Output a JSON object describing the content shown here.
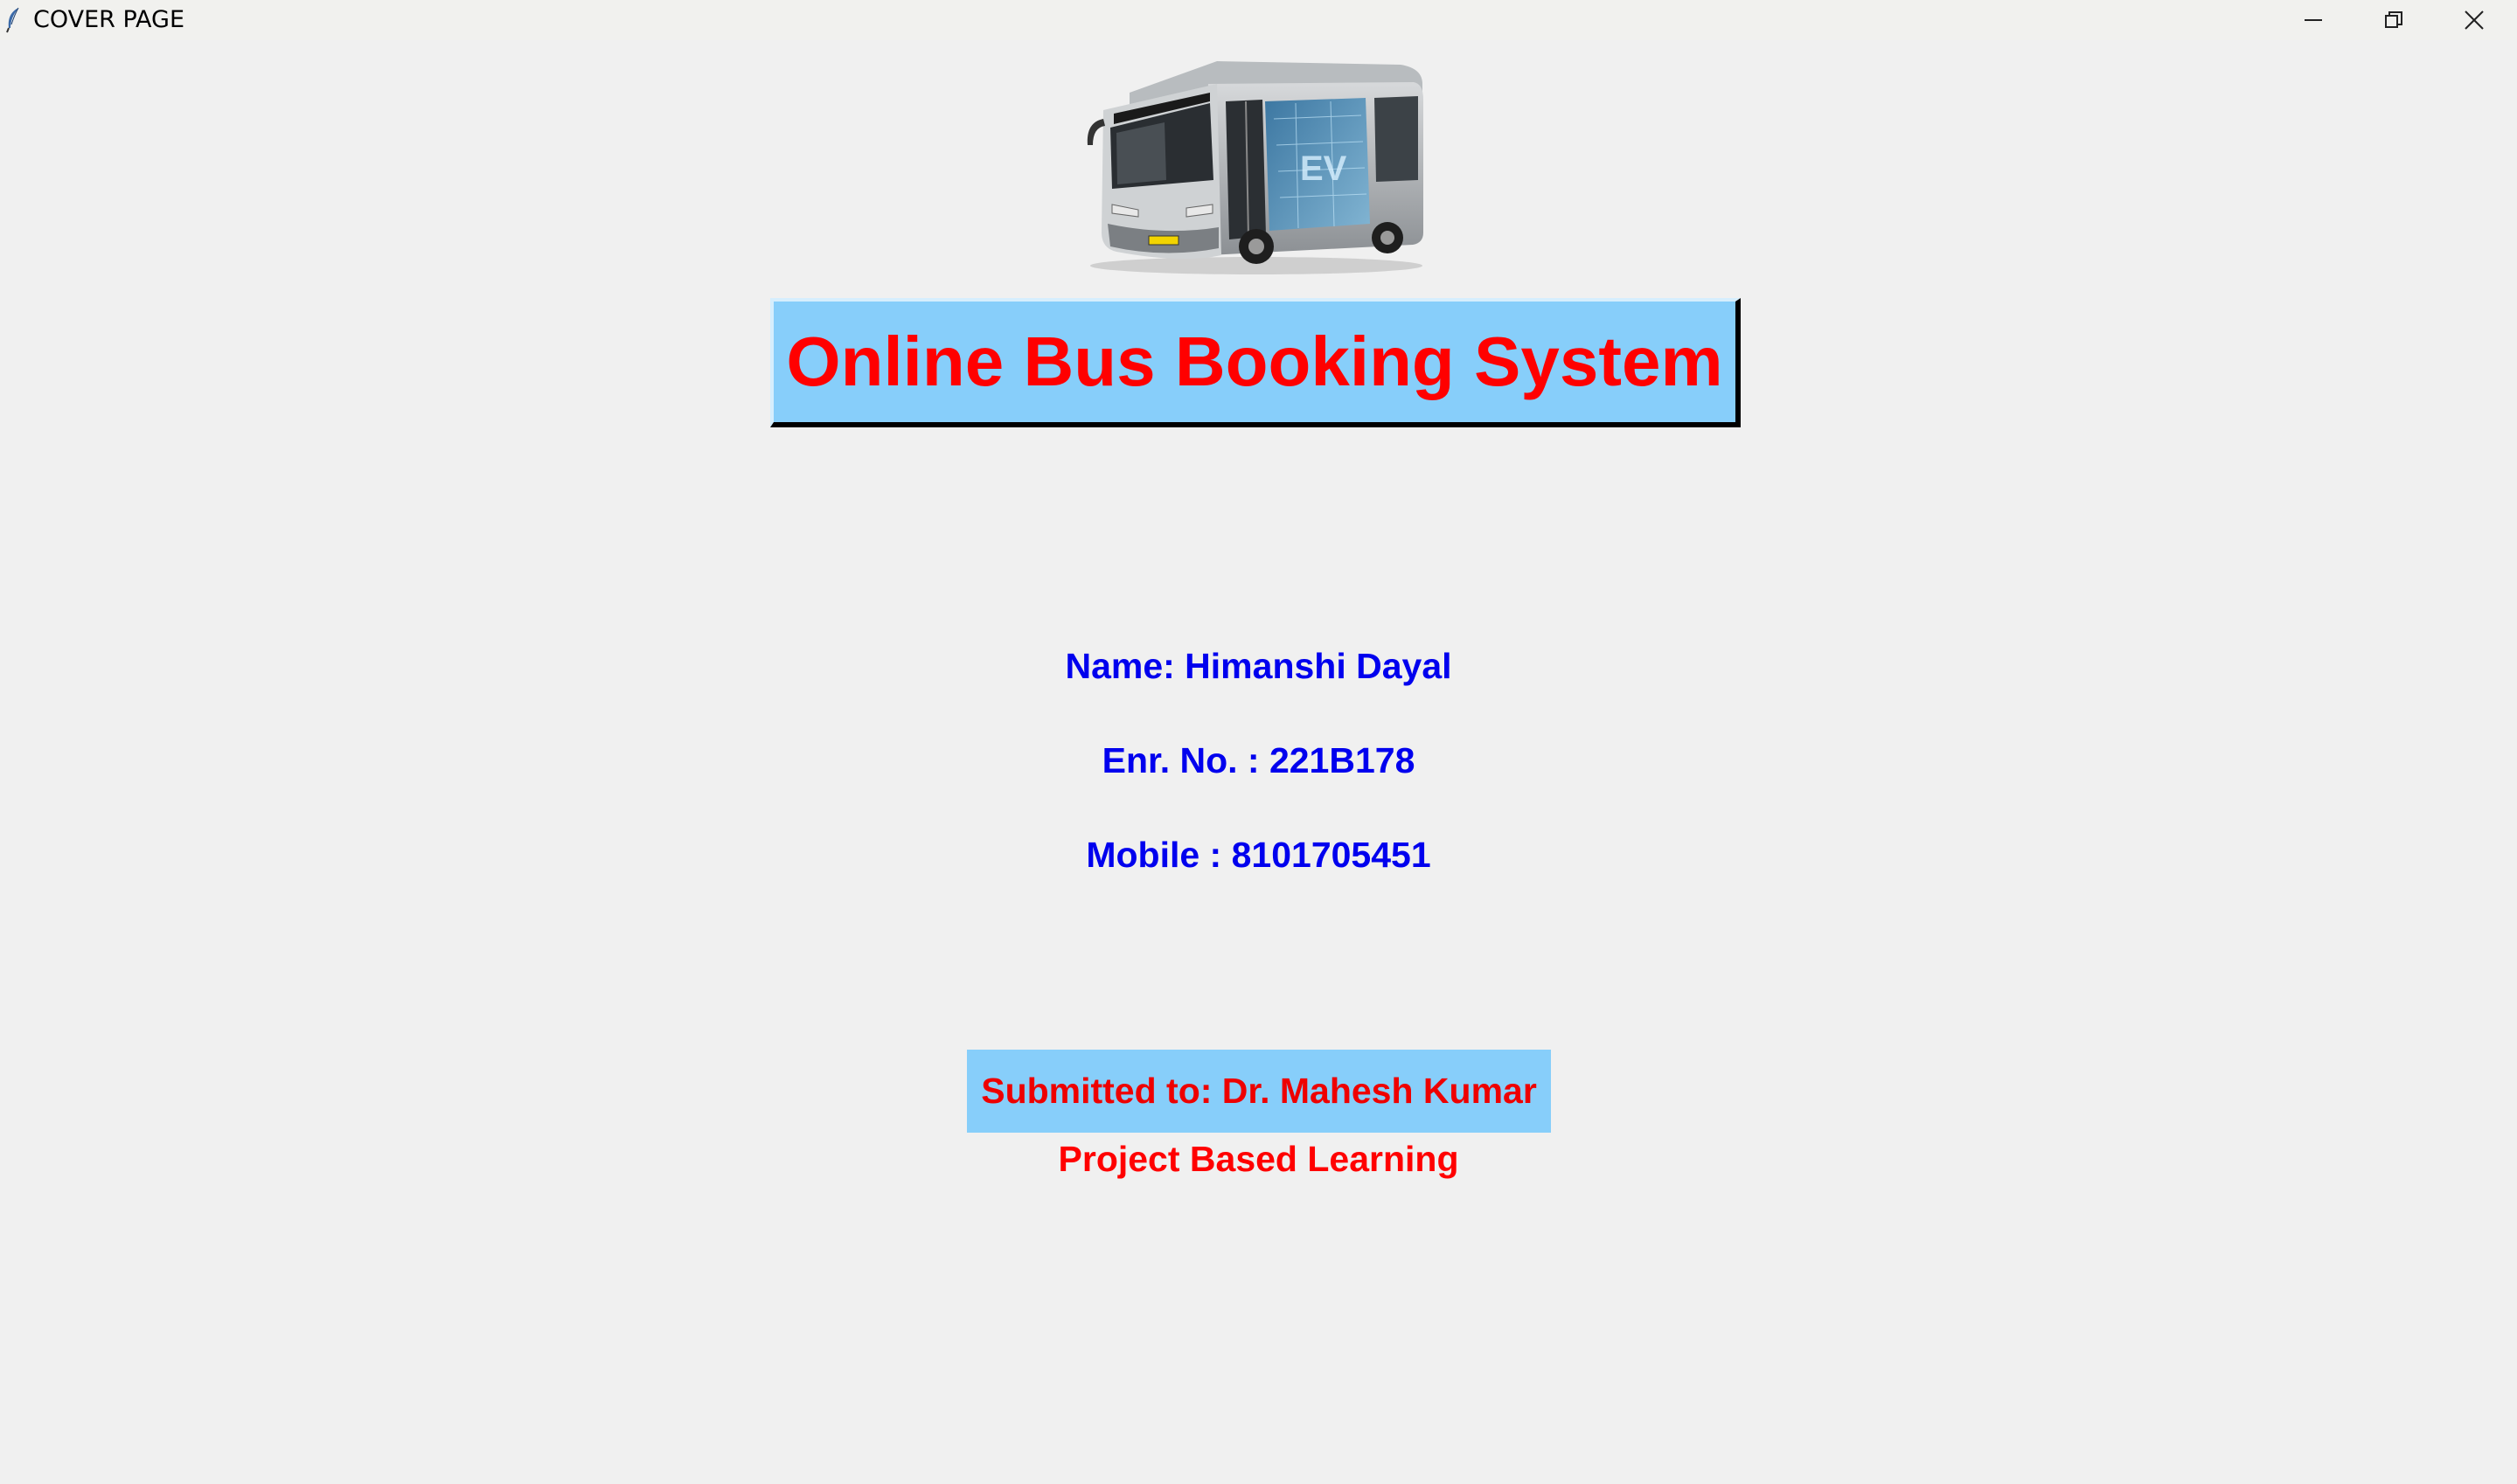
{
  "window": {
    "title": "COVER PAGE",
    "icons": {
      "app": "feather-icon",
      "minimize": "minimize-icon",
      "maximize": "restore-icon",
      "close": "close-icon"
    }
  },
  "cover": {
    "image": "electric-bus-image",
    "title": "Online Bus Booking System",
    "name_line": "Name: Himanshi Dayal",
    "enr_line": "Enr. No. : 221B178",
    "mobile_line": "Mobile : 8101705451",
    "submitted_line": "Submitted to: Dr. Mahesh Kumar",
    "footer_line": "Project Based Learning"
  },
  "colors": {
    "background": "#f0f0f0",
    "banner": "#87cefa",
    "title_text": "#ff0000",
    "info_text": "#0000ee"
  }
}
